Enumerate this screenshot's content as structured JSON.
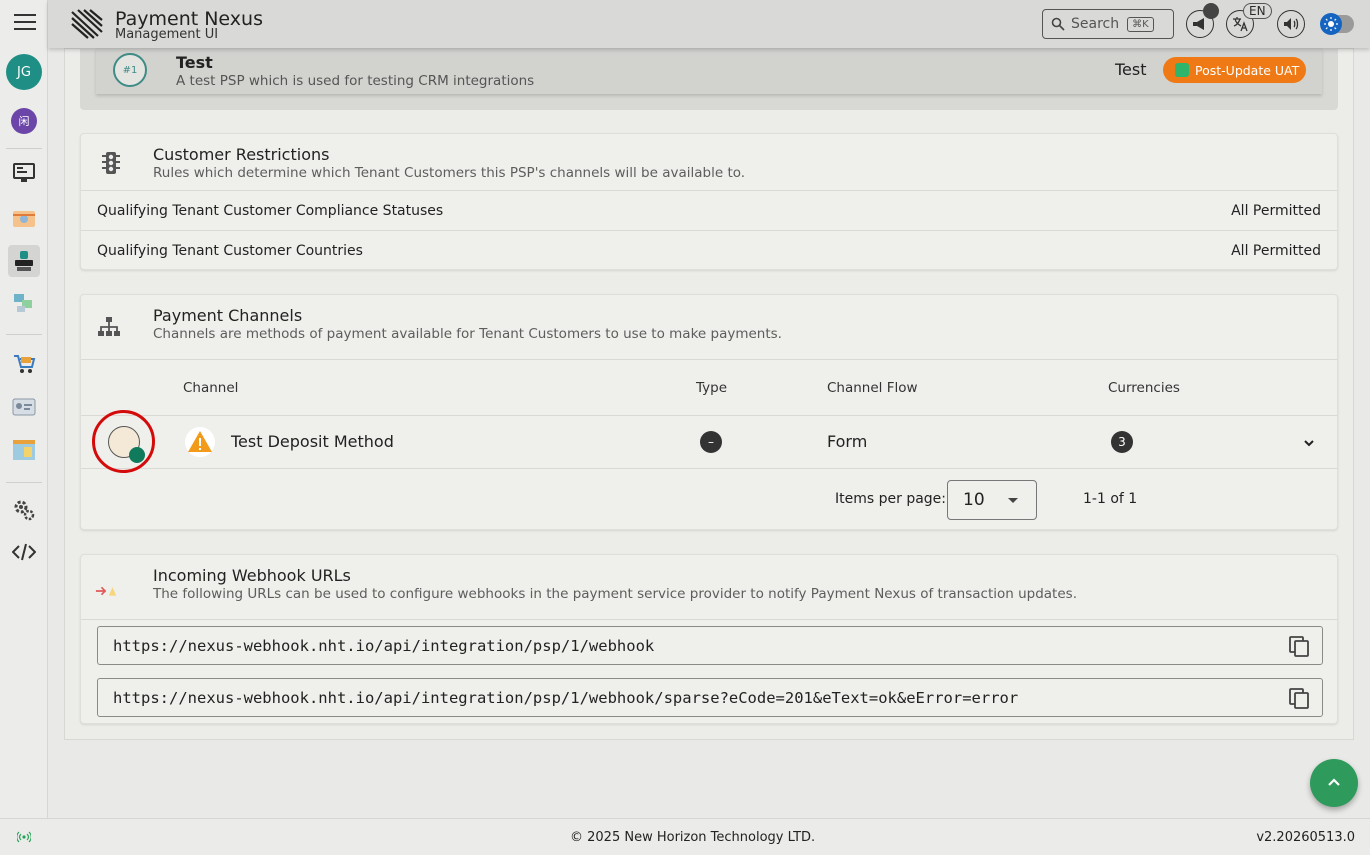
{
  "header": {
    "brand": "Payment Nexus",
    "brand_sub": "Management UI",
    "search_label": "Search",
    "search_shortcut": "⌘K",
    "language": "EN"
  },
  "rail": {
    "avatar_initials": "JG",
    "tenant_glyph": "闲"
  },
  "psp": {
    "number": "#1",
    "title": "Test",
    "description": "A test PSP which is used for testing CRM integrations",
    "environment": "Test",
    "status_chip": "Post-Update UAT"
  },
  "restrictions": {
    "title": "Customer Restrictions",
    "subtitle": "Rules which determine which Tenant Customers this PSP's channels will be available to.",
    "rows": [
      {
        "label": "Qualifying Tenant Customer Compliance Statuses",
        "value": "All Permitted"
      },
      {
        "label": "Qualifying Tenant Customer Countries",
        "value": "All Permitted"
      }
    ]
  },
  "channels": {
    "title": "Payment Channels",
    "subtitle": "Channels are methods of payment available for Tenant Customers to use to make payments.",
    "columns": {
      "channel": "Channel",
      "type": "Type",
      "flow": "Channel Flow",
      "currencies": "Currencies"
    },
    "rows": [
      {
        "name": "Test Deposit Method",
        "type": "–",
        "flow": "Form",
        "currencies": "3"
      }
    ],
    "pager": {
      "items_label": "Items per page:",
      "items_value": "10",
      "range": "1-1 of 1"
    }
  },
  "webhooks": {
    "title": "Incoming Webhook URLs",
    "subtitle": "The following URLs can be used to configure webhooks in the payment service provider to notify Payment Nexus of transaction updates.",
    "urls": [
      "https://nexus-webhook.nht.io/api/integration/psp/1/webhook",
      "https://nexus-webhook.nht.io/api/integration/psp/1/webhook/sparse?eCode=201&eText=ok&eError=error"
    ]
  },
  "footer": {
    "copyright": "© 2025 New Horizon Technology LTD.",
    "version": "v2.20260513.0"
  },
  "colors": {
    "accent_orange": "#ef7a15",
    "teal": "#1f8f86",
    "fab_green": "#2e9a5b",
    "highlight_red": "#d40b0b"
  }
}
